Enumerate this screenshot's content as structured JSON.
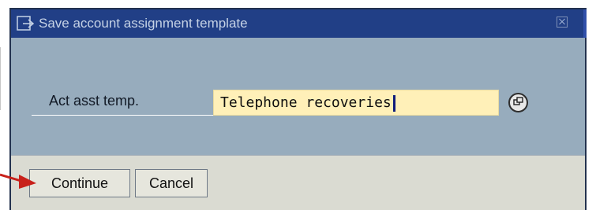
{
  "window": {
    "title": "Save account assignment template",
    "icon": "dialog-arrow-icon",
    "close_icon": "close-icon"
  },
  "form": {
    "label": "Act asst temp.",
    "value": "Telephone recoveries",
    "help_icon": "possible-entries-icon"
  },
  "buttons": {
    "continue_label": "Continue",
    "cancel_label": "Cancel"
  },
  "annotation": {
    "arrow_icon": "red-arrow-icon",
    "arrow_color": "#c8211b"
  },
  "colors": {
    "titlebar": "#213f86",
    "dialog_body": "#97acbd",
    "input_background": "#fff0b8",
    "footer": "#dadbd2"
  }
}
